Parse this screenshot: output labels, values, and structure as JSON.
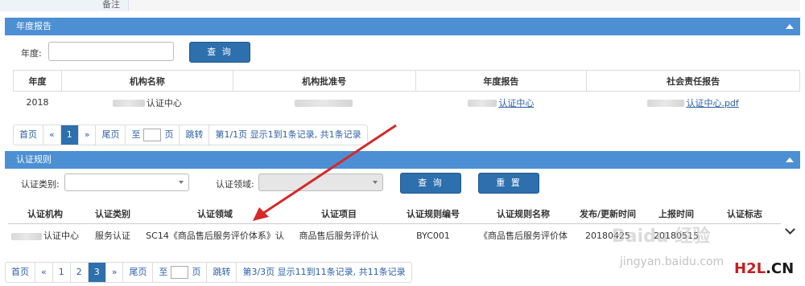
{
  "top": {
    "remark_label": "备注"
  },
  "annual": {
    "panel_title": "年度报告",
    "year_label": "年度:",
    "year_value": "",
    "query_button": "查 询",
    "headers": [
      "年度",
      "机构名称",
      "机构批准号",
      "年度报告",
      "社会责任报告"
    ],
    "row": {
      "year": "2018",
      "org_name": "认证中心",
      "approval_no": "",
      "annual_report": "认证中心",
      "csr_report": "认证中心.pdf"
    },
    "pager": {
      "first": "首页",
      "prev": "«",
      "page": "1",
      "next": "»",
      "last": "尾页",
      "goto_prefix": "至",
      "goto_suffix": "页",
      "jump": "跳转",
      "info": "第1/1页 显示1到1条记录, 共1条记录"
    }
  },
  "rules": {
    "panel_title": "认证规则",
    "category_label": "认证类别:",
    "category_value": "",
    "field_label": "认证领域:",
    "field_value": "",
    "query_button": "查 询",
    "reset_button": "重 置",
    "headers": [
      "认证机构",
      "认证类别",
      "认证领域",
      "认证项目",
      "认证规则编号",
      "认证规则名称",
      "发布/更新时间",
      "上报时间",
      "认证标志"
    ],
    "row": {
      "org": "认证中心",
      "category": "服务认证",
      "field": "SC14《商品售后服务评价体系》认",
      "project": "商品售后服务评价认",
      "rule_no": "BYC001",
      "rule_name": "《商品售后服务评价体",
      "publish_time": "20180425",
      "report_time": "20180515",
      "mark": ""
    },
    "pager": {
      "first": "首页",
      "prev": "«",
      "pages": [
        "1",
        "2",
        "3"
      ],
      "active": "3",
      "next": "»",
      "last": "尾页",
      "goto_prefix": "至",
      "goto_suffix": "页",
      "jump": "跳转",
      "info": "第3/3页 显示11到11条记录, 共11条记录"
    }
  },
  "watermark": {
    "baidu": "Baidu 经验",
    "url": "jingyan.baidu.com",
    "h2l_h": "H2L",
    "h2l_d": ".CN"
  },
  "colors": {
    "panel_header": "#4d8fd3",
    "button": "#2e6fad",
    "arrow": "#d42a2a",
    "link": "#2a5ea8"
  }
}
